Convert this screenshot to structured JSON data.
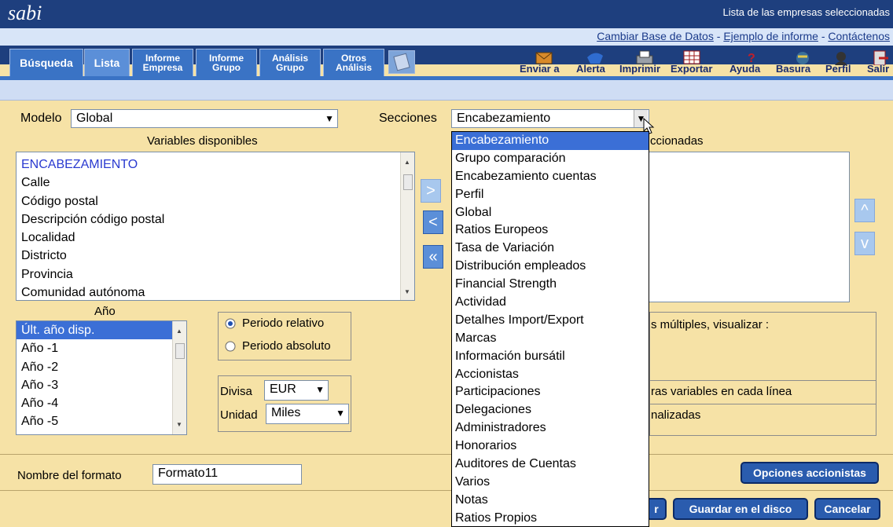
{
  "app": {
    "logo": "sabi",
    "header_right": "Lista de las empresas seleccionadas"
  },
  "links": {
    "change_db": "Cambiar Base de Datos",
    "sep": " - ",
    "example": "Ejemplo de informe",
    "contact": "Contáctenos"
  },
  "tabs": [
    {
      "l1": "Búsqueda",
      "l2": ""
    },
    {
      "l1": "Lista",
      "l2": ""
    },
    {
      "l1": "Informe",
      "l2": "Empresa"
    },
    {
      "l1": "Informe",
      "l2": "Grupo"
    },
    {
      "l1": "Análisis",
      "l2": "Grupo"
    },
    {
      "l1": "Otros",
      "l2": "Análisis"
    }
  ],
  "toolbar": {
    "send": "Enviar a",
    "alert": "Alerta",
    "print": "Imprimir",
    "export": "Exportar",
    "help": "Ayuda",
    "trash": "Basura",
    "profile": "Perfil",
    "exit": "Salir"
  },
  "form": {
    "modelo_label": "Modelo",
    "modelo_value": "Global",
    "secciones_label": "Secciones",
    "secciones_value": "Encabezamiento",
    "variables_disponibles": "Variables disponibles",
    "variables_seleccionadas": "ccionadas",
    "variables": [
      "ENCABEZAMIENTO",
      "Calle",
      "Código postal",
      "Descripción código postal",
      "Localidad",
      "Districto",
      "Provincia",
      "Comunidad autónoma"
    ],
    "anio_label": "Año",
    "anios": [
      "Últ. año disp.",
      "Año -1",
      "Año -2",
      "Año -3",
      "Año -4",
      "Año -5"
    ],
    "periodo_relativo": "Periodo relativo",
    "periodo_absoluto": "Periodo absoluto",
    "divisa_label": "Divisa",
    "divisa_value": "EUR",
    "unidad_label": "Unidad",
    "unidad_value": "Miles",
    "multiples_text": "s múltiples, visualizar :",
    "otras_text": "ras variables en cada línea",
    "personalizadas_text": "nalizadas",
    "nombre_label": "Nombre del formato",
    "nombre_value": "Formato11"
  },
  "secciones_options": [
    "Encabezamiento",
    "Grupo comparación",
    "Encabezamiento cuentas",
    "Perfil",
    "Global",
    "Ratios Europeos",
    "Tasa de Variación",
    "Distribución empleados",
    "Financial Strength",
    "Actividad",
    "Detalhes Import/Export",
    "Marcas",
    "Información bursátil",
    "Accionistas",
    "Participaciones",
    "Delegaciones",
    "Administradores",
    "Honorarios",
    "Auditores de Cuentas",
    "Varios",
    "Notas",
    "Ratios Propios"
  ],
  "buttons": {
    "opciones_accionistas": "Opciones accionistas",
    "partial": "r",
    "guardar_disco": "Guardar en el disco",
    "cancelar": "Cancelar"
  },
  "colors": {
    "topbar": "#1e3f7e",
    "panel": "#f6e2a6",
    "tab": "#3a73c5",
    "selection": "#3b6fd6",
    "button": "#2a5cae"
  }
}
